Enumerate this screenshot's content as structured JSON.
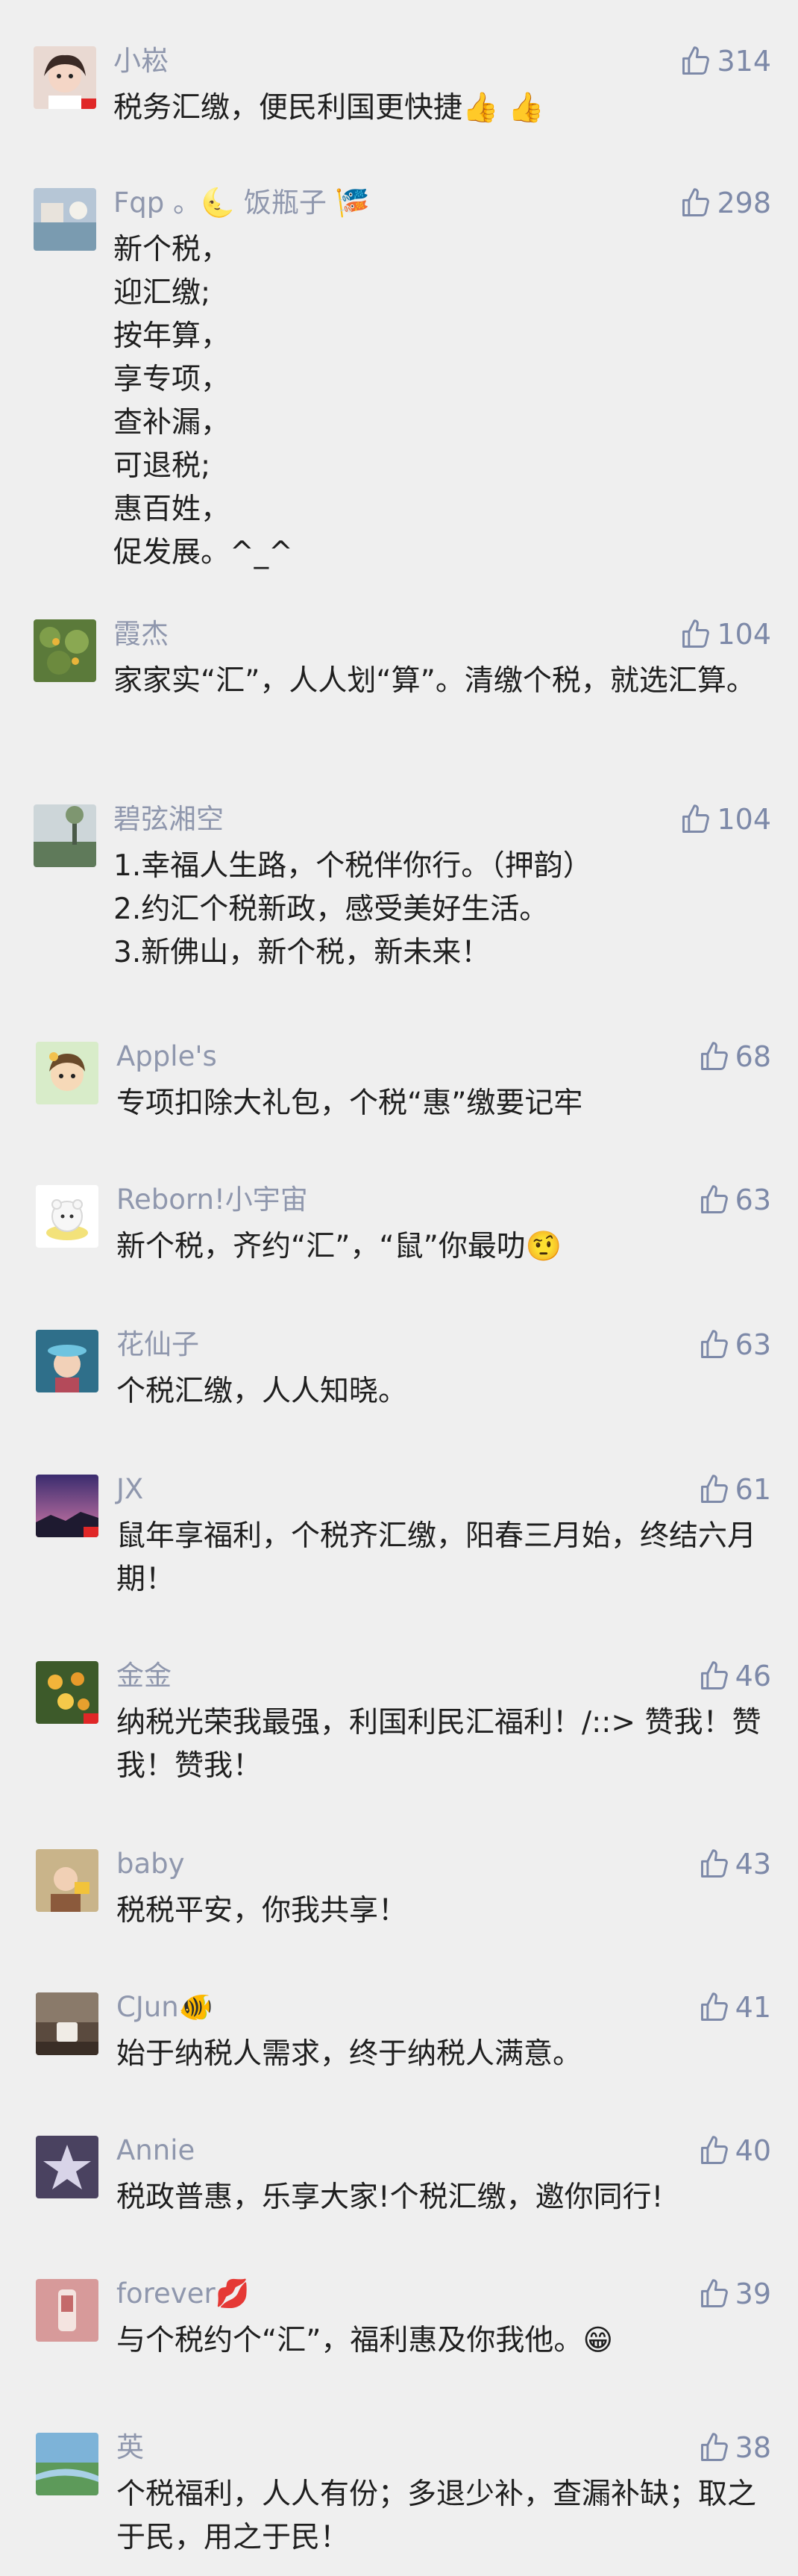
{
  "comments": [
    {
      "name": "小崧",
      "likes": "314",
      "text": "税务汇缴，便民利国更快捷👍 👍"
    },
    {
      "name": "Fqp 。🌜 饭瓶子 🎏",
      "likes": "298",
      "text": "新个税，\n迎汇缴;\n按年算，\n享专项，\n查补漏，\n可退税;\n惠百姓，\n促发展。^_^"
    },
    {
      "name": "霞杰",
      "likes": "104",
      "text": "家家实“汇”，人人划“算”。清缴个税，就选汇算。"
    },
    {
      "name": "碧弦湘空",
      "likes": "104",
      "text": "1.幸福人生路，个税伴你行。（押韵）\n2.约汇个税新政，感受美好生活。\n3.新佛山，新个税，新未来！"
    },
    {
      "name": "Apple's",
      "likes": "68",
      "text": "专项扣除大礼包，个税“惠”缴要记牢"
    },
    {
      "name": "Reborn!小宇宙",
      "likes": "63",
      "text": "新个税，齐约“汇”，“鼠”你最叻🤨"
    },
    {
      "name": "花仙子",
      "likes": "63",
      "text": "个税汇缴，人人知晓。"
    },
    {
      "name": "JX",
      "likes": "61",
      "text": "鼠年享福利，个税齐汇缴，阳春三月始，终结六月期！"
    },
    {
      "name": "金金",
      "likes": "46",
      "text": "纳税光荣我最强，利国利民汇福利！/::> 赞我！赞我！赞我！"
    },
    {
      "name": "baby",
      "likes": "43",
      "text": "税税平安，你我共享！"
    },
    {
      "name": "CJun🐠",
      "likes": "41",
      "text": "始于纳税人需求，终于纳税人满意。"
    },
    {
      "name": "Annie",
      "likes": "40",
      "text": "税政普惠，乐享大家!个税汇缴，邀你同行!"
    },
    {
      "name": "forever💋",
      "likes": "39",
      "text": "与个税约个“汇”，福利惠及你我他。😁"
    },
    {
      "name": "英",
      "likes": "38",
      "text": "个税福利，人人有份；多退少补，查漏补缺；取之于民，用之于民！"
    }
  ]
}
